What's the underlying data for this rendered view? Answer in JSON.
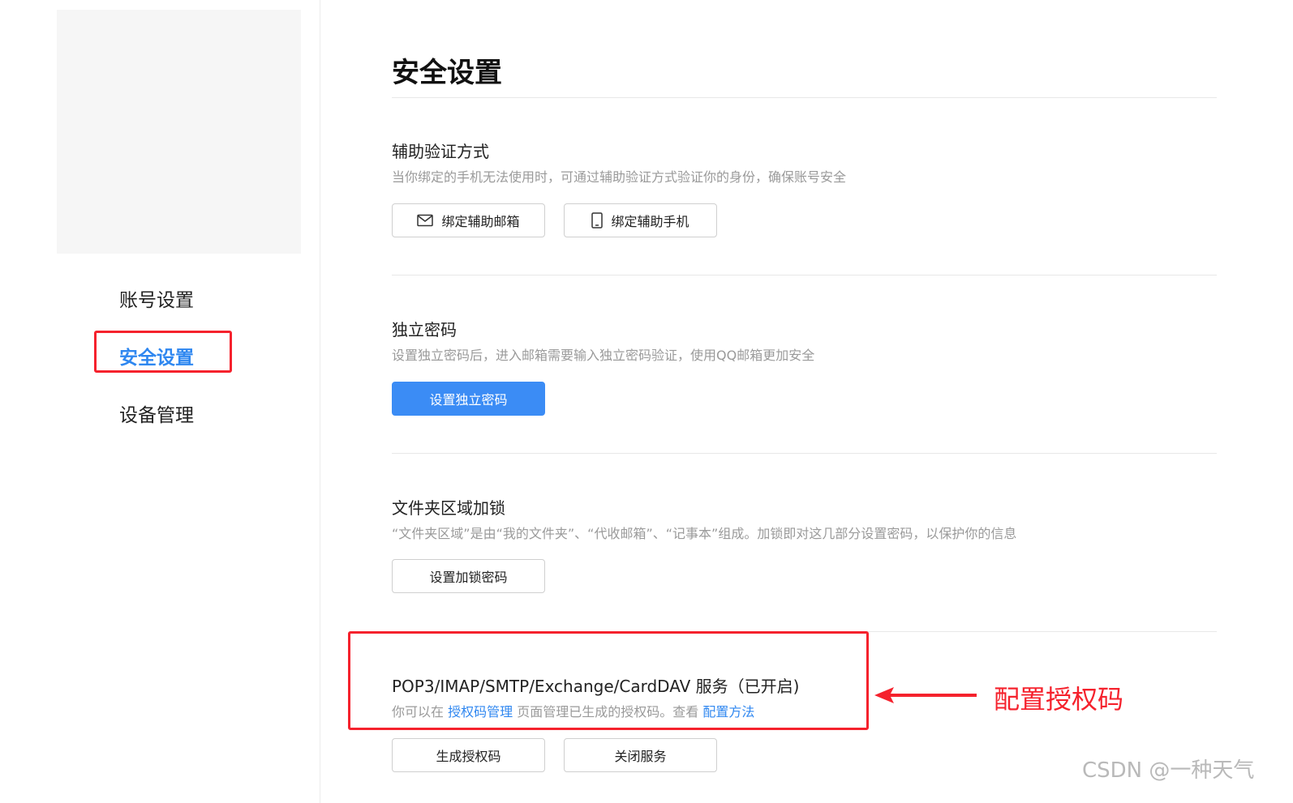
{
  "sidebar": {
    "items": [
      {
        "label": "账号设置",
        "active": false
      },
      {
        "label": "安全设置",
        "active": true
      },
      {
        "label": "设备管理",
        "active": false
      }
    ]
  },
  "page": {
    "title": "安全设置"
  },
  "sections": {
    "aux_verify": {
      "title": "辅助验证方式",
      "desc": "当你绑定的手机无法使用时，可通过辅助验证方式验证你的身份，确保账号安全",
      "btn_email": "绑定辅助邮箱",
      "btn_phone": "绑定辅助手机"
    },
    "independent_pwd": {
      "title": "独立密码",
      "desc": "设置独立密码后，进入邮箱需要输入独立密码验证，使用QQ邮箱更加安全",
      "btn": "设置独立密码"
    },
    "folder_lock": {
      "title": "文件夹区域加锁",
      "desc": "“文件夹区域”是由“我的文件夹”、“代收邮箱”、“记事本”组成。加锁即对这几部分设置密码，以保护你的信息",
      "btn": "设置加锁密码"
    },
    "pop_service": {
      "title": "POP3/IMAP/SMTP/Exchange/CardDAV 服务（已开启)",
      "desc_prefix": "你可以在",
      "desc_link1": "授权码管理",
      "desc_middle": "页面管理已生成的授权码。查看",
      "desc_link2": "配置方法",
      "btn_generate": "生成授权码",
      "btn_close": "关闭服务"
    }
  },
  "annotation": {
    "text": "配置授权码",
    "color": "#f5222d"
  },
  "watermark": "CSDN @一种天气",
  "colors": {
    "accent": "#2f87f0",
    "primary_button": "#3b8cf5",
    "highlight": "#f5222d"
  }
}
